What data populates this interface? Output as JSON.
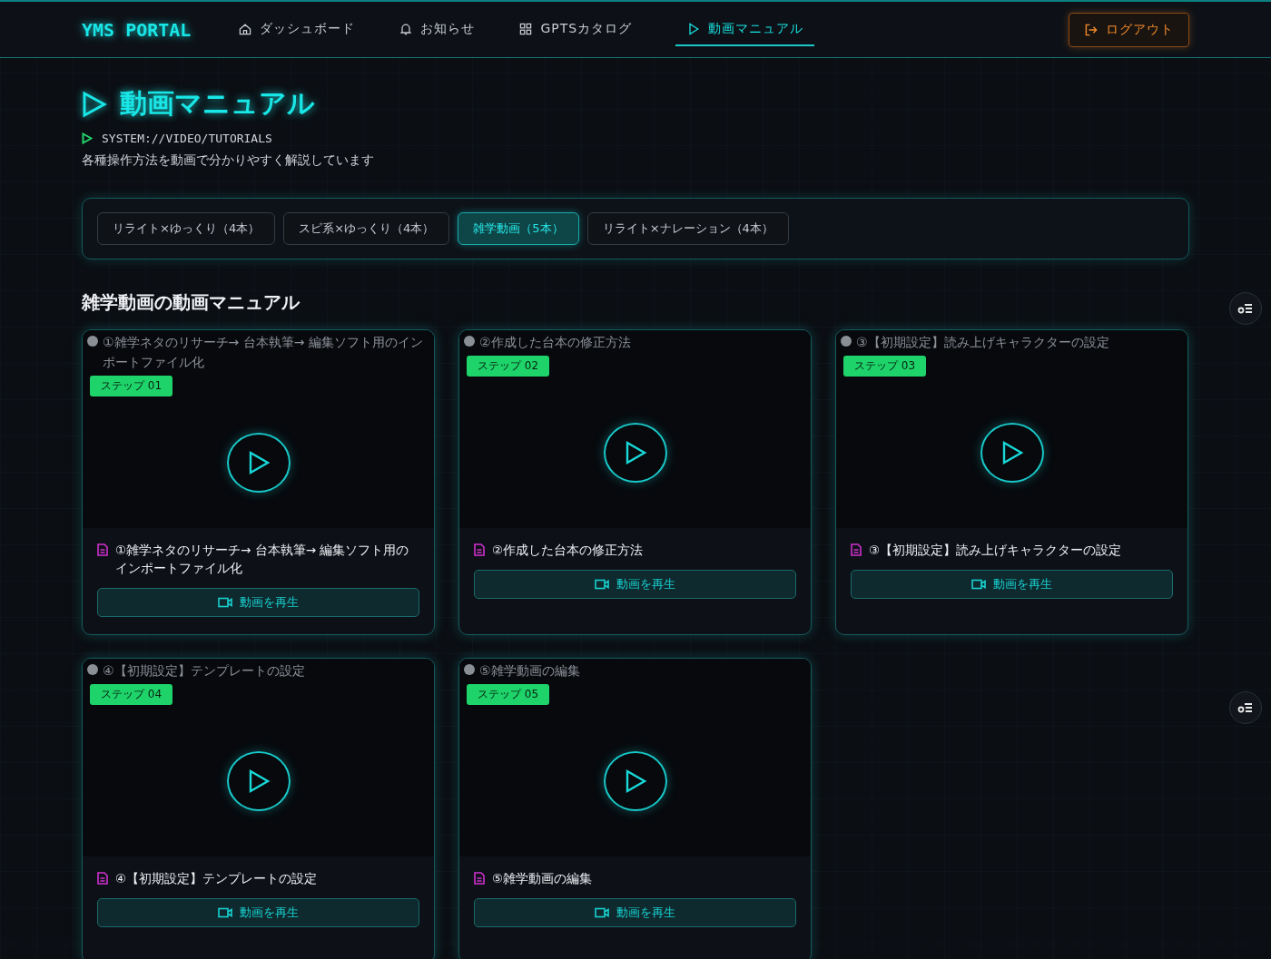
{
  "header": {
    "logo": "YMS PORTAL",
    "nav": [
      {
        "kind": "home",
        "label": "ダッシュボード",
        "selected": false
      },
      {
        "kind": "bell",
        "label": "お知らせ",
        "selected": false
      },
      {
        "kind": "grid",
        "label": "GPTSカタログ",
        "selected": false
      },
      {
        "kind": "play",
        "label": "動画マニュアル",
        "selected": true
      }
    ],
    "logout": "ログアウト"
  },
  "page": {
    "title": "動画マニュアル",
    "path": "SYSTEM://VIDEO/TUTORIALS",
    "description": "各種操作方法を動画で分かりやすく解説しています"
  },
  "filters": [
    {
      "label": "リライト×ゆっくり（4本）",
      "selected": false
    },
    {
      "label": "スピ系×ゆっくり（4本）",
      "selected": false
    },
    {
      "label": "雑学動画（5本）",
      "selected": true
    },
    {
      "label": "リライト×ナレーション（4本）",
      "selected": false
    }
  ],
  "section_title": "雑学動画の動画マニュアル",
  "videos": [
    {
      "alt": "①雑学ネタのリサーチ→ 台本執筆→ 編集ソフト用のインポートファイル化",
      "step": "ステップ 01",
      "title": "①雑学ネタのリサーチ→ 台本執筆→ 編集ソフト用のインポートファイル化",
      "button": "動画を再生"
    },
    {
      "alt": "②作成した台本の修正方法",
      "step": "ステップ 02",
      "title": "②作成した台本の修正方法",
      "button": "動画を再生"
    },
    {
      "alt": "③【初期設定】読み上げキャラクターの設定",
      "step": "ステップ 03",
      "title": "③【初期設定】読み上げキャラクターの設定",
      "button": "動画を再生"
    },
    {
      "alt": "④【初期設定】テンプレートの設定",
      "step": "ステップ 04",
      "title": "④【初期設定】テンプレートの設定",
      "button": "動画を再生"
    },
    {
      "alt": "⑤雑学動画の編集",
      "step": "ステップ 05",
      "title": "⑤雑学動画の編集",
      "button": "動画を再生"
    }
  ]
}
